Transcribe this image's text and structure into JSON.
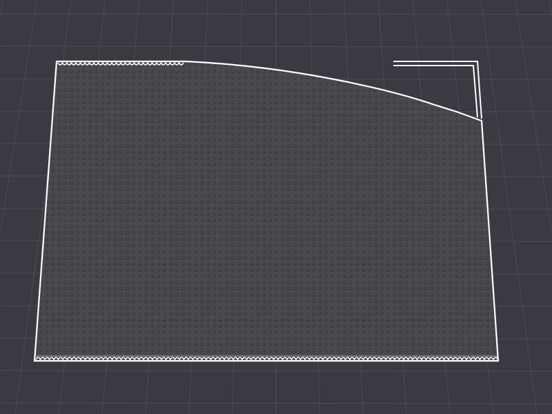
{
  "viewport": {
    "background_color": "#3a3a42",
    "grid_color": "#4d4d56",
    "view": "3d-perspective"
  },
  "build_plate": {
    "fill_color": "#4a4a4e",
    "texture_dot_color": "#3c3c40",
    "texture_highlight_color": "#58585c",
    "edge_color": "#ffffff",
    "edge_pattern": "scalloped"
  },
  "frame_guide": {
    "line_color": "#ffffff"
  }
}
